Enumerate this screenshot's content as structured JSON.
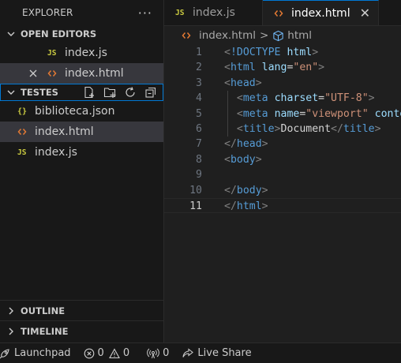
{
  "explorer": {
    "title": "EXPLORER",
    "more": "···"
  },
  "open_editors": {
    "label": "OPEN EDITORS",
    "items": [
      {
        "badge": "JS",
        "name": "index.js"
      },
      {
        "badge": "<>",
        "name": "index.html"
      }
    ]
  },
  "folder": {
    "label": "TESTES",
    "items": [
      {
        "badge": "{}",
        "name": "biblioteca.json"
      },
      {
        "badge": "<>",
        "name": "index.html"
      },
      {
        "badge": "JS",
        "name": "index.js"
      }
    ]
  },
  "outline": {
    "label": "OUTLINE"
  },
  "timeline": {
    "label": "TIMELINE"
  },
  "tabs": [
    {
      "badge": "JS",
      "label": "index.js"
    },
    {
      "badge": "<>",
      "label": "index.html",
      "close": "✕"
    }
  ],
  "breadcrumb": {
    "file": "index.html",
    "sep": ">",
    "symbol": "html"
  },
  "code": {
    "line_numbers": [
      "1",
      "2",
      "3",
      "4",
      "5",
      "6",
      "7",
      "8",
      "9",
      "10",
      "11"
    ],
    "active_line": "11"
  },
  "statusbar": {
    "launchpad": "Launchpad",
    "errors": "0",
    "warnings": "0",
    "ports": "0",
    "live_share": "Live Share"
  },
  "colors": {
    "accent": "#0078d4",
    "html_icon": "#e37933",
    "js_icon": "#cbcb41"
  }
}
